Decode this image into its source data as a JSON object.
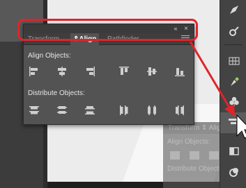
{
  "panel": {
    "collapse_glyph": "«",
    "close_glyph": "×",
    "tabs": [
      {
        "label": "Transform",
        "active": false
      },
      {
        "label": "⇕Align",
        "active": true
      },
      {
        "label": "Pathfinder",
        "active": false
      }
    ],
    "align_label": "Align Objects:",
    "distribute_label": "Distribute Objects:",
    "align_icons": [
      "horizontal-align-left-icon",
      "horizontal-align-center-icon",
      "horizontal-align-right-icon",
      "vertical-align-top-icon",
      "vertical-align-center-icon",
      "vertical-align-bottom-icon"
    ],
    "distribute_icons": [
      "vertical-distribute-top-icon",
      "vertical-distribute-center-icon",
      "vertical-distribute-bottom-icon",
      "horizontal-distribute-left-icon",
      "horizontal-distribute-center-icon",
      "horizontal-distribute-right-icon"
    ]
  },
  "docked_panel": {
    "tabs_text": "Transform  ⇕ Align",
    "align_label": "Align Objects:",
    "distribute_label": "Distribute Objects:"
  },
  "toolstrip": {
    "icons": [
      "paintbrush-icon",
      "symbols-icon",
      "swatches-grid-icon",
      "brushes-icon",
      "clover-symbols-icon",
      "align-panel-icon",
      "layers-icon",
      "appearance-icon",
      "graphic-styles-icon"
    ]
  },
  "colors": {
    "annotation": "#e0242a",
    "panel_bg": "#535353",
    "tab_bar": "#3e3e3e",
    "icon": "#cfcfcf"
  }
}
